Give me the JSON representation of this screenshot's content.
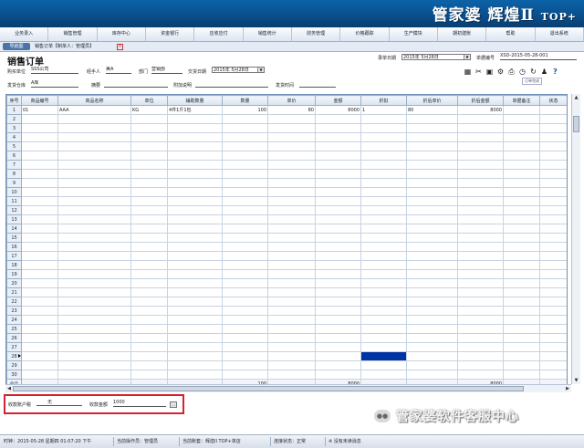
{
  "app": {
    "logo_text": "管家婆 辉煌Ⅱ",
    "logo_suffix": "TOP+"
  },
  "menu": [
    "业务录入",
    "销售管理",
    "库存中心",
    "资金银行",
    "应收应付",
    "销售统计",
    "财务管理",
    "价格跟踪",
    "生产模块",
    "期初建账",
    "帮助",
    "退出系统"
  ],
  "tabs": {
    "home": "导航图",
    "current": "销售订单【制单人：管理员】"
  },
  "order": {
    "title": "销售订单",
    "date_label": "录单日期",
    "date_value": "2015年 5月28日",
    "doc_no_label": "单据编号",
    "doc_no_value": "XSD-2015-05-28-001",
    "customer_label": "购买单位",
    "customer_value": "SSS公司",
    "handler_label": "经手人",
    "handler_value": "美A",
    "dept_label": "部门",
    "dept_value": "营销部",
    "delivery_label": "交货日期",
    "delivery_value": "2015年 5月28日",
    "warehouse_label": "发货仓库",
    "warehouse_value": "A库",
    "summary_label": "摘要",
    "summary_value": "",
    "notes_label": "附加说明",
    "notes_value": "",
    "shipped_label": "发货时间",
    "shipped_value": "",
    "print_label": "订单完成"
  },
  "icons": [
    "calculator-icon",
    "cut-icon",
    "grid-icon",
    "gear-icon",
    "print-icon",
    "clock-icon",
    "refresh-icon",
    "user-icon",
    "help-icon"
  ],
  "grid": {
    "headers": [
      "序号",
      "商品编号",
      "商品名称",
      "单位",
      "辅助数量",
      "数量",
      "单价",
      "金额",
      "折扣",
      "折后单价",
      "折后金额",
      "单据备注",
      "状态"
    ],
    "rows": [
      [
        "1",
        "01",
        "AAA",
        "KG",
        "4件1斤1包",
        "100",
        "80",
        "8000",
        "1",
        "80",
        "8000",
        "",
        ""
      ]
    ],
    "row_count": 30,
    "selected_row": 28,
    "highlight_row": 28,
    "highlight_col": 8,
    "total_label": "合计",
    "totals": [
      "",
      "",
      "",
      "",
      "",
      "100",
      "",
      "8000",
      "",
      "",
      "8000",
      "",
      ""
    ]
  },
  "payment": {
    "account_label": "收款账户税",
    "account_value": "无",
    "amount_label": "收款金额",
    "amount_value": "1000",
    "button": "..."
  },
  "watermark": "管家婆软件客服中心",
  "status": {
    "time": "时钟：2015-05-28 星期四 01:07:20 下午",
    "operator": "当前操作员：管理员",
    "company": "当前账套：辉煌II TOP+单店",
    "state": "连接状态：正常",
    "unread": "※ 没有未读消息"
  },
  "colors": {
    "banner": "#0a4e8a",
    "highlight": "#0033a3",
    "payment_outline": "#d3232f"
  }
}
